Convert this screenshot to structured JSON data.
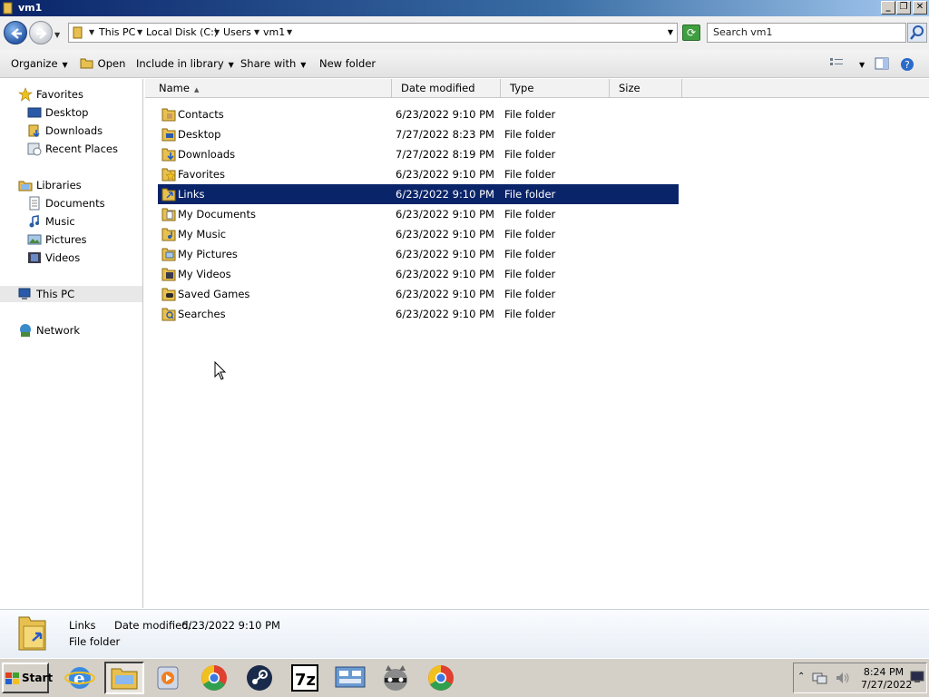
{
  "window": {
    "title": "vm1"
  },
  "address": {
    "crumbs": [
      "This PC",
      "Local Disk (C:)",
      "Users",
      "vm1"
    ],
    "search_placeholder": "Search vm1"
  },
  "toolbar": {
    "organize": "Organize",
    "open": "Open",
    "include_in_library": "Include in library",
    "share_with": "Share with",
    "new_folder": "New folder"
  },
  "nav": {
    "favorites": "Favorites",
    "favorites_items": [
      "Desktop",
      "Downloads",
      "Recent Places"
    ],
    "libraries": "Libraries",
    "libraries_items": [
      "Documents",
      "Music",
      "Pictures",
      "Videos"
    ],
    "this_pc": "This PC",
    "network": "Network"
  },
  "columns": {
    "name": "Name",
    "date": "Date modified",
    "type": "Type",
    "size": "Size"
  },
  "files": [
    {
      "name": "Contacts",
      "date": "6/23/2022 9:10 PM",
      "type": "File folder"
    },
    {
      "name": "Desktop",
      "date": "7/27/2022 8:23 PM",
      "type": "File folder"
    },
    {
      "name": "Downloads",
      "date": "7/27/2022 8:19 PM",
      "type": "File folder"
    },
    {
      "name": "Favorites",
      "date": "6/23/2022 9:10 PM",
      "type": "File folder"
    },
    {
      "name": "Links",
      "date": "6/23/2022 9:10 PM",
      "type": "File folder"
    },
    {
      "name": "My Documents",
      "date": "6/23/2022 9:10 PM",
      "type": "File folder"
    },
    {
      "name": "My Music",
      "date": "6/23/2022 9:10 PM",
      "type": "File folder"
    },
    {
      "name": "My Pictures",
      "date": "6/23/2022 9:10 PM",
      "type": "File folder"
    },
    {
      "name": "My Videos",
      "date": "6/23/2022 9:10 PM",
      "type": "File folder"
    },
    {
      "name": "Saved Games",
      "date": "6/23/2022 9:10 PM",
      "type": "File folder"
    },
    {
      "name": "Searches",
      "date": "6/23/2022 9:10 PM",
      "type": "File folder"
    }
  ],
  "details": {
    "name": "Links",
    "date_label": "Date modified:",
    "date_value": "6/23/2022 9:10 PM",
    "type": "File folder"
  },
  "taskbar": {
    "start": "Start",
    "apps": [
      "internet-explorer-icon",
      "file-explorer-icon",
      "media-player-icon",
      "chrome-icon",
      "steam-icon",
      "7zip-icon",
      "control-panel-icon",
      "raccoon-app-icon",
      "chrome-icon"
    ],
    "clock_time": "8:24 PM",
    "clock_date": "7/27/2022"
  },
  "colors": {
    "selection": "#0a246a",
    "titlebar": "#0a246a",
    "taskbar": "#d4d0c8"
  }
}
